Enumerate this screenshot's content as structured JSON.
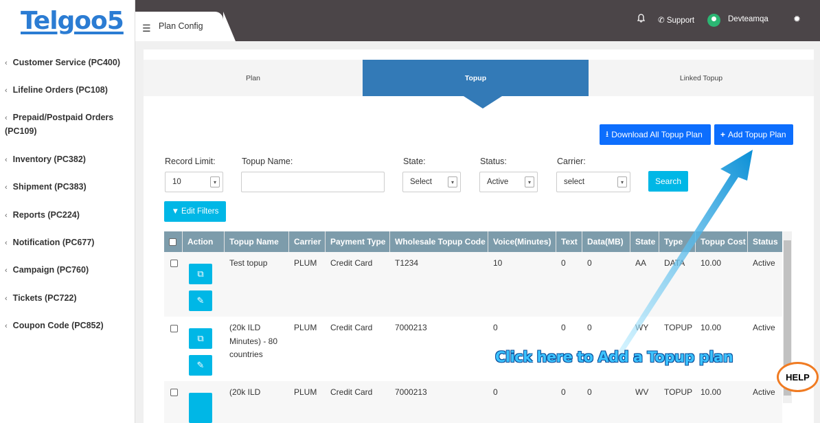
{
  "sidebar": {
    "logo": "Telgoo5",
    "items": [
      {
        "label": "Customer Service (PC400)"
      },
      {
        "label": "Lifeline Orders (PC108)"
      },
      {
        "label": "Prepaid/Postpaid Orders (PC109)"
      },
      {
        "label": "Inventory (PC382)"
      },
      {
        "label": "Shipment (PC383)"
      },
      {
        "label": "Reports (PC224)"
      },
      {
        "label": "Notification (PC677)"
      },
      {
        "label": "Campaign (PC760)"
      },
      {
        "label": "Tickets (PC722)"
      },
      {
        "label": "Coupon Code (PC852)"
      }
    ]
  },
  "header": {
    "title": "Plan Config",
    "support": "Support",
    "user": "Devteamqa"
  },
  "tabs": {
    "plan": "Plan",
    "topup": "Topup",
    "linked": "Linked Topup"
  },
  "buttons": {
    "download": "Download All Topup Plan",
    "add": "Add Topup Plan",
    "search": "Search",
    "edit_filters": "Edit Filters"
  },
  "filters": {
    "record_limit_label": "Record Limit:",
    "record_limit_value": "10",
    "topup_name_label": "Topup Name:",
    "topup_name_value": "",
    "state_label": "State:",
    "state_value": "Select",
    "status_label": "Status:",
    "status_value": "Active",
    "carrier_label": "Carrier:",
    "carrier_value": "select"
  },
  "table": {
    "headers": [
      "Action",
      "Topup Name",
      "Carrier",
      "Payment Type",
      "Wholesale Topup Code",
      "Voice(Minutes)",
      "Text",
      "Data(MB)",
      "State",
      "Type",
      "Topup Cost",
      "Status"
    ],
    "rows": [
      {
        "name": "Test topup",
        "carrier": "PLUM",
        "payment": "Credit Card",
        "code": "T1234",
        "voice": "10",
        "text": "0",
        "data": "0",
        "state": "AA",
        "type": "DATA",
        "cost": "10.00",
        "status": "Active"
      },
      {
        "name": "(20k ILD Minutes) - 80 countries",
        "carrier": "PLUM",
        "payment": "Credit Card",
        "code": "7000213",
        "voice": "0",
        "text": "0",
        "data": "0",
        "state": "WY",
        "type": "TOPUP",
        "cost": "10.00",
        "status": "Active"
      },
      {
        "name": "(20k ILD",
        "carrier": "PLUM",
        "payment": "Credit Card",
        "code": "7000213",
        "voice": "0",
        "text": "0",
        "data": "0",
        "state": "WV",
        "type": "TOPUP",
        "cost": "10.00",
        "status": "Active"
      }
    ]
  },
  "annotation": "Click here to Add a Topup plan",
  "help": "HELP",
  "icons": {
    "hamburger": "menu-icon",
    "bell": "bell-icon",
    "phone": "phone-icon",
    "gear": "gear-icon",
    "copy": "copy-icon",
    "edit": "pencil-icon",
    "download": "download-icon",
    "plus": "plus-icon",
    "filter": "filter-icon"
  },
  "colors": {
    "accent": "#337ab7",
    "primary_button": "#0d6efd",
    "cyan_button": "#00b7e6",
    "table_header": "#7d9cab",
    "topbar": "#4b4548"
  }
}
